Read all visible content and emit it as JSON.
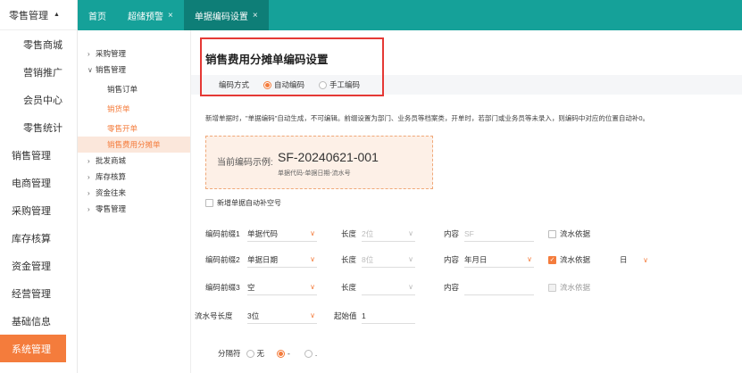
{
  "sidebar": {
    "header": "零售管理",
    "items": [
      {
        "label": "零售商城",
        "level": "sub"
      },
      {
        "label": "营销推广",
        "level": "sub"
      },
      {
        "label": "会员中心",
        "level": "sub"
      },
      {
        "label": "零售统计",
        "level": "sub"
      },
      {
        "label": "销售管理",
        "level": "top"
      },
      {
        "label": "电商管理",
        "level": "top"
      },
      {
        "label": "采购管理",
        "level": "top"
      },
      {
        "label": "库存核算",
        "level": "top"
      },
      {
        "label": "资金管理",
        "level": "top"
      },
      {
        "label": "经营管理",
        "level": "top"
      },
      {
        "label": "基础信息",
        "level": "top"
      },
      {
        "label": "系统管理",
        "level": "top",
        "active": true
      }
    ]
  },
  "tabs": [
    {
      "label": "首页",
      "closable": false
    },
    {
      "label": "超储预警",
      "closable": true
    },
    {
      "label": "单据编码设置",
      "closable": true,
      "active": true
    }
  ],
  "subnav": {
    "items": [
      {
        "label": "采购管理",
        "level": 1,
        "arrow": ">"
      },
      {
        "label": "销售管理",
        "level": 1,
        "arrow": "∨"
      },
      {
        "label": "销售订单",
        "level": 2
      },
      {
        "label": "销货单",
        "level": 2,
        "state": "orange"
      },
      {
        "label": "零售开单",
        "level": 2,
        "state": "orange"
      },
      {
        "label": "销售费用分摊单",
        "level": 2,
        "state": "selected"
      },
      {
        "label": "批发商城",
        "level": 1,
        "arrow": ">"
      },
      {
        "label": "库存核算",
        "level": 1,
        "arrow": ">"
      },
      {
        "label": "资金往来",
        "level": 1,
        "arrow": ">"
      },
      {
        "label": "零售管理",
        "level": 1,
        "arrow": ">"
      }
    ]
  },
  "main": {
    "title": "销售费用分摊单编码设置",
    "method_label": "编码方式",
    "method_auto": "自动编码",
    "method_manual": "手工编码",
    "description": "新增单据时，\"单据编码\"自动生成，不可编辑。前缀设置为部门、业务员等档案类，开单时，若部门或业务员等未录入，则编码中对应的位置自动补0。",
    "example_label": "当前编码示例:",
    "example_value": "SF-20240621-001",
    "example_sub": "单据代码-单据日期-流水号",
    "autofill_label": "新增单据自动补空号",
    "prefix_rows": [
      {
        "label": "编码前缀1",
        "value": "单据代码",
        "length_label": "长度",
        "length": "2位",
        "length_disabled": true,
        "content_label": "内容",
        "content": "SF",
        "content_placeholder": true,
        "flow_label": "流水依据",
        "flow_checked": false,
        "flow_disabled": false,
        "flow_unit": ""
      },
      {
        "label": "编码前缀2",
        "value": "单据日期",
        "length_label": "长度",
        "length": "8位",
        "length_disabled": true,
        "content_label": "内容",
        "content": "年月日",
        "content_placeholder": false,
        "flow_label": "流水依据",
        "flow_checked": true,
        "flow_disabled": false,
        "flow_unit": "日"
      },
      {
        "label": "编码前缀3",
        "value": "空",
        "length_label": "长度",
        "length": "",
        "length_disabled": false,
        "content_label": "内容",
        "content": "",
        "content_placeholder": false,
        "flow_label": "流水依据",
        "flow_checked": false,
        "flow_disabled": true,
        "flow_unit": ""
      }
    ],
    "serial_label": "流水号长度",
    "serial_value": "3位",
    "start_label": "起始值",
    "start_value": "1",
    "separator_label": "分隔符",
    "separator_options": [
      {
        "label": "无",
        "checked": false
      },
      {
        "label": "-",
        "checked": true
      },
      {
        "label": ".",
        "checked": false
      }
    ]
  },
  "colors": {
    "teal": "#15a199",
    "orange": "#f47c3c",
    "highlight_border": "#e53935"
  }
}
